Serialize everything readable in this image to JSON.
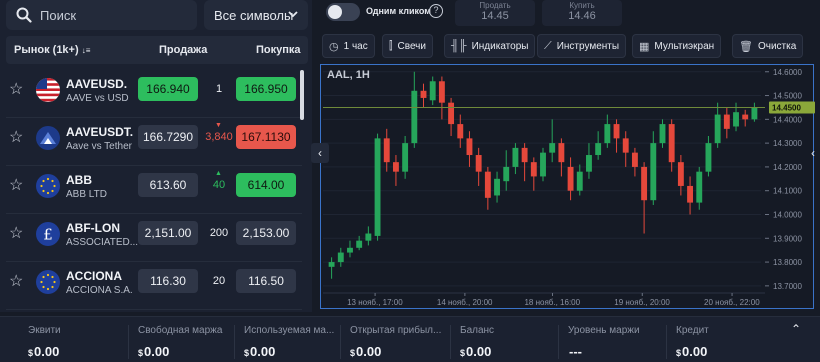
{
  "search": {
    "placeholder": "Поиск",
    "icon": "search-icon"
  },
  "symbols_select": {
    "value": "Все символы"
  },
  "table": {
    "col_market": "Рынок (1k+)",
    "col_sell": "Продажа",
    "col_buy": "Покупка",
    "rows": [
      {
        "symbol": "AAVEUSD.",
        "desc": "AAVE vs USD",
        "sell": "166.940",
        "spread": "1",
        "buy": "166.950",
        "sell_state": "green",
        "buy_state": "green",
        "trend": ""
      },
      {
        "symbol": "AAVEUSDT.",
        "desc": "Aave vs Tether",
        "sell": "166.7290",
        "spread": "3,840",
        "buy": "167.1130",
        "sell_state": "neutral",
        "buy_state": "red",
        "trend": "down"
      },
      {
        "symbol": "ABB",
        "desc": "ABB LTD",
        "sell": "613.60",
        "spread": "40",
        "buy": "614.00",
        "sell_state": "neutral",
        "buy_state": "green",
        "trend": "up"
      },
      {
        "symbol": "ABF-LON",
        "desc": "ASSOCIATED...",
        "sell": "2,151.00",
        "spread": "200",
        "buy": "2,153.00",
        "sell_state": "neutral",
        "buy_state": "neutral",
        "trend": ""
      },
      {
        "symbol": "ACCIONA",
        "desc": "ACCIONA S.A.",
        "sell": "116.30",
        "spread": "20",
        "buy": "116.50",
        "sell_state": "neutral",
        "buy_state": "neutral",
        "trend": ""
      }
    ]
  },
  "topbar": {
    "one_click_label": "Одним кликом",
    "sell_label": "Продать",
    "sell_value": "14.45",
    "buy_label": "Купить",
    "buy_value": "14.46"
  },
  "toolbar": {
    "timeframe": "1 час",
    "candles": "Свечи",
    "indicators": "Индикаторы",
    "instruments": "Инструменты",
    "multiscreen": "Мультиэкран",
    "clear": "Очистка"
  },
  "chart_data": {
    "type": "candlestick",
    "title": "AAL, 1H",
    "current_price": "14.4500",
    "y_ticks": [
      "14.6000",
      "14.5000",
      "14.4000",
      "14.3000",
      "14.2000",
      "14.1000",
      "14.0000",
      "13.9000",
      "13.8000",
      "13.7000"
    ],
    "ylim": [
      13.67,
      14.62
    ],
    "x_ticks": [
      "13 нояб., 17:00",
      "14 нояб., 20:00",
      "18 нояб., 16:00",
      "19 нояб., 20:00",
      "20 нояб., 22:00"
    ],
    "colors": {
      "up": "#26a65b",
      "down": "#e5483b",
      "price_line": "#6f8a3a",
      "border": "#3a73c9"
    },
    "candles": [
      [
        13.78,
        13.8,
        13.73,
        13.82
      ],
      [
        13.8,
        13.84,
        13.78,
        13.86
      ],
      [
        13.84,
        13.86,
        13.82,
        13.89
      ],
      [
        13.86,
        13.89,
        13.85,
        13.91
      ],
      [
        13.89,
        13.92,
        13.87,
        13.95
      ],
      [
        13.91,
        14.32,
        13.89,
        14.34
      ],
      [
        14.32,
        14.22,
        14.18,
        14.36
      ],
      [
        14.22,
        14.18,
        14.12,
        14.25
      ],
      [
        14.18,
        14.3,
        14.15,
        14.33
      ],
      [
        14.3,
        14.52,
        14.28,
        14.6
      ],
      [
        14.52,
        14.49,
        14.45,
        14.55
      ],
      [
        14.48,
        14.56,
        14.46,
        14.58
      ],
      [
        14.56,
        14.47,
        14.4,
        14.58
      ],
      [
        14.47,
        14.38,
        14.33,
        14.49
      ],
      [
        14.38,
        14.32,
        14.28,
        14.42
      ],
      [
        14.32,
        14.25,
        14.2,
        14.35
      ],
      [
        14.25,
        14.18,
        14.12,
        14.28
      ],
      [
        14.18,
        14.07,
        14.02,
        14.2
      ],
      [
        14.08,
        14.15,
        14.05,
        14.18
      ],
      [
        14.14,
        14.2,
        14.1,
        14.27
      ],
      [
        14.2,
        14.28,
        14.17,
        14.3
      ],
      [
        14.28,
        14.22,
        14.14,
        14.3
      ],
      [
        14.22,
        14.16,
        14.1,
        14.24
      ],
      [
        14.16,
        14.26,
        14.14,
        14.28
      ],
      [
        14.26,
        14.3,
        14.22,
        14.4
      ],
      [
        14.3,
        14.22,
        14.16,
        14.32
      ],
      [
        14.2,
        14.1,
        14.06,
        14.24
      ],
      [
        14.1,
        14.18,
        14.08,
        14.21
      ],
      [
        14.18,
        14.25,
        14.15,
        14.3
      ],
      [
        14.25,
        14.3,
        14.23,
        14.35
      ],
      [
        14.3,
        14.38,
        14.28,
        14.42
      ],
      [
        14.38,
        14.32,
        14.26,
        14.4
      ],
      [
        14.32,
        14.26,
        14.2,
        14.35
      ],
      [
        14.26,
        14.2,
        14.16,
        14.28
      ],
      [
        14.2,
        14.06,
        13.92,
        14.22
      ],
      [
        14.06,
        14.3,
        14.04,
        14.35
      ],
      [
        14.3,
        14.38,
        14.28,
        14.4
      ],
      [
        14.38,
        14.22,
        14.18,
        14.4
      ],
      [
        14.22,
        14.12,
        14.08,
        14.25
      ],
      [
        14.12,
        14.05,
        14.0,
        14.16
      ],
      [
        14.05,
        14.18,
        14.02,
        14.2
      ],
      [
        14.18,
        14.3,
        14.16,
        14.33
      ],
      [
        14.3,
        14.42,
        14.28,
        14.47
      ],
      [
        14.42,
        14.36,
        14.32,
        14.45
      ],
      [
        14.37,
        14.43,
        14.35,
        14.47
      ],
      [
        14.42,
        14.4,
        14.37,
        14.44
      ],
      [
        14.4,
        14.45,
        14.39,
        14.47
      ]
    ]
  },
  "bottom": {
    "stats": [
      {
        "label": "Эквити",
        "currency": "$",
        "value": "0.00"
      },
      {
        "label": "Свободная маржа",
        "currency": "$",
        "value": "0.00"
      },
      {
        "label": "Используемая ма...",
        "currency": "$",
        "value": "0.00"
      },
      {
        "label": "Открытая прибыл...",
        "currency": "$",
        "value": "0.00"
      },
      {
        "label": "Баланс",
        "currency": "$",
        "value": "0.00"
      },
      {
        "label": "Уровень маржи",
        "currency": "",
        "value": "---"
      },
      {
        "label": "Кредит",
        "currency": "$",
        "value": "0.00"
      }
    ]
  }
}
